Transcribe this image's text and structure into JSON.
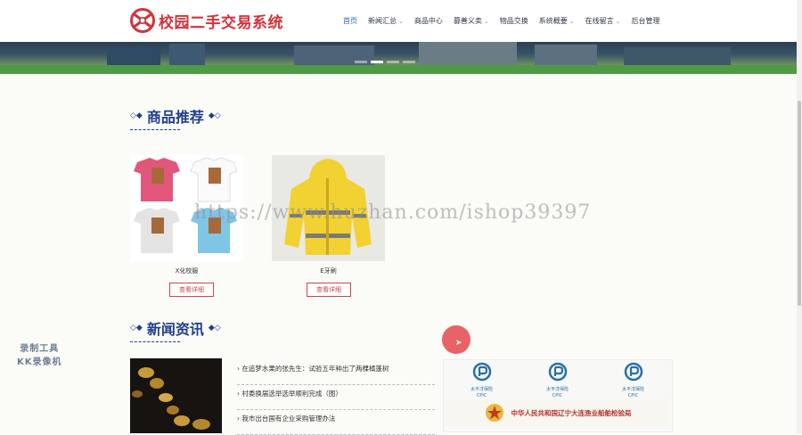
{
  "site": {
    "title": "校园二手交易系统",
    "brand_color": "#d3323b"
  },
  "nav": {
    "items": [
      {
        "label": "首页",
        "dropdown": false,
        "active": true
      },
      {
        "label": "新闻汇总",
        "dropdown": true
      },
      {
        "label": "商品中心",
        "dropdown": false
      },
      {
        "label": "募善义卖",
        "dropdown": true
      },
      {
        "label": "物品交换",
        "dropdown": false
      },
      {
        "label": "系统概要",
        "dropdown": true
      },
      {
        "label": "在线留言",
        "dropdown": true
      },
      {
        "label": "后台管理",
        "dropdown": false
      }
    ]
  },
  "products": {
    "title": "商品推荐",
    "items": [
      {
        "name": "X化校服",
        "button": "查看详细"
      },
      {
        "name": "E牙刷",
        "button": "查看详细"
      }
    ]
  },
  "news": {
    "title": "新闻资讯",
    "items": [
      "在追梦水果的张先生：试验五年种出了两棵橘蓬树",
      "村委换届选举选举顺利完成（图）",
      "我市出台国有企业采购管理办法"
    ]
  },
  "partners": {
    "logos": [
      {
        "name": "太平洋保险"
      },
      {
        "name": "太平洋保险"
      },
      {
        "name": "太平洋保险"
      }
    ],
    "logo_sub": "CPIC",
    "gov": "中华人民共和国辽宁大连渔业船舶检验局"
  },
  "overlay": {
    "watermark": "https://www.huzhan.com/ishop39397",
    "recorder_line1": "录制工具",
    "recorder_line2": "KK录像机"
  }
}
